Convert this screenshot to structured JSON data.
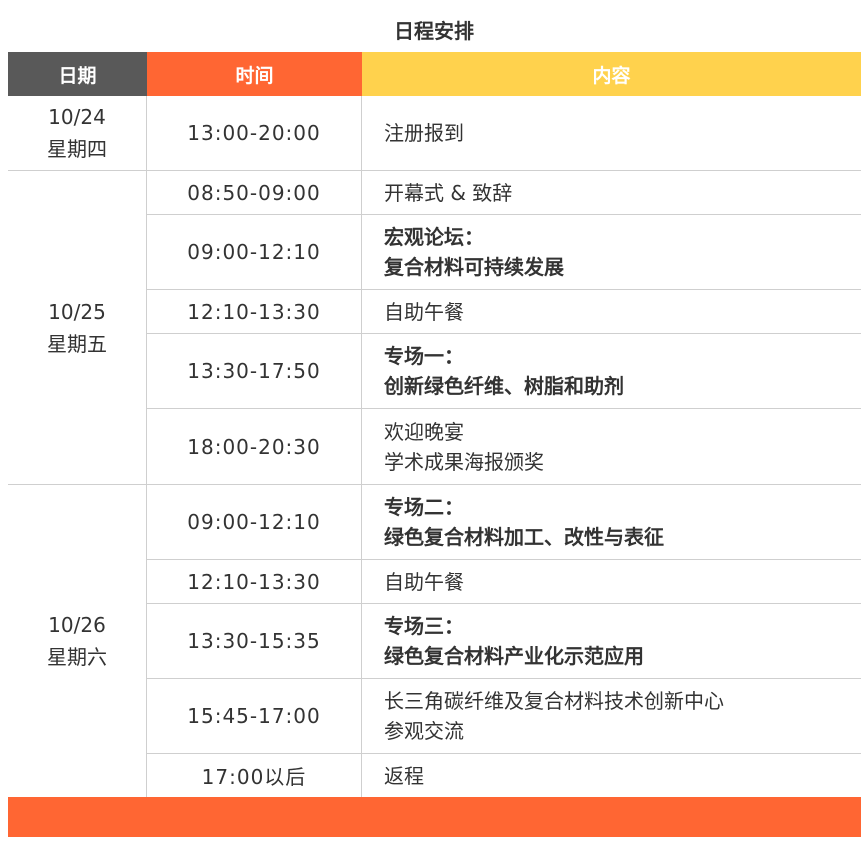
{
  "title": "日程安排",
  "headers": {
    "date": "日期",
    "time": "时间",
    "content": "内容"
  },
  "colors": {
    "date_header": "#595959",
    "time_header": "#ff6633",
    "content_header": "#ffd24d",
    "footer": "#ff6633"
  },
  "days": [
    {
      "date": "10/24",
      "weekday": "星期四"
    },
    {
      "date": "10/25",
      "weekday": "星期五"
    },
    {
      "date": "10/26",
      "weekday": "星期六"
    }
  ],
  "rows": [
    {
      "time": "13:00-20:00",
      "line1": "注册报到",
      "line2": ""
    },
    {
      "time": "08:50-09:00",
      "line1": "开幕式 & 致辞",
      "line2": ""
    },
    {
      "time": "09:00-12:10",
      "line1": "宏观论坛：",
      "line2": "复合材料可持续发展"
    },
    {
      "time": "12:10-13:30",
      "line1": "自助午餐",
      "line2": ""
    },
    {
      "time": "13:30-17:50",
      "line1": "专场一：",
      "line2": "创新绿色纤维、树脂和助剂"
    },
    {
      "time": "18:00-20:30",
      "line1": "欢迎晚宴",
      "line2": "学术成果海报颁奖"
    },
    {
      "time": "09:00-12:10",
      "line1": "专场二：",
      "line2": "绿色复合材料加工、改性与表征"
    },
    {
      "time": "12:10-13:30",
      "line1": "自助午餐",
      "line2": ""
    },
    {
      "time": "13:30-15:35",
      "line1": "专场三：",
      "line2": "绿色复合材料产业化示范应用"
    },
    {
      "time": "15:45-17:00",
      "line1": "长三角碳纤维及复合材料技术创新中心",
      "line2": "参观交流"
    },
    {
      "time": "17:00以后",
      "line1": "返程",
      "line2": ""
    }
  ]
}
